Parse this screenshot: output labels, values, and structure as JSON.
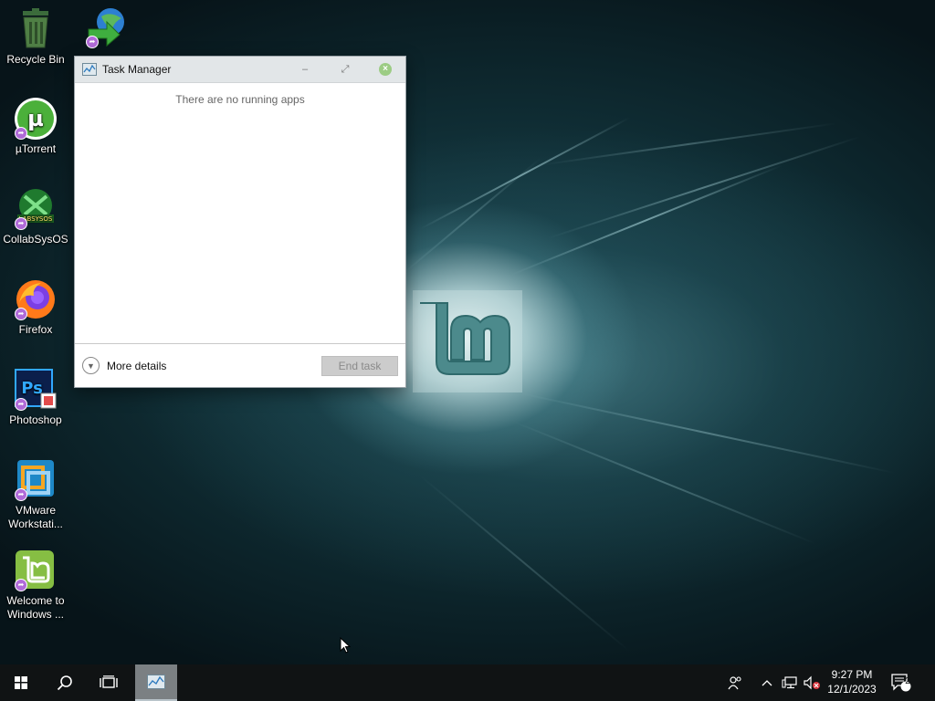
{
  "desktop": {
    "icons": [
      {
        "name": "recycle-bin",
        "label": "Recycle Bin"
      },
      {
        "name": "internet-download-manager",
        "label": ""
      },
      {
        "name": "utorrent",
        "label": "µTorrent"
      },
      {
        "name": "collabsysos",
        "label": "CollabSysOS",
        "badge_text": "LABSYSOS"
      },
      {
        "name": "firefox",
        "label": "Firefox"
      },
      {
        "name": "photoshop",
        "label": "Photoshop",
        "badge_text": "Ps"
      },
      {
        "name": "vmware-workstation",
        "label": "VMware Workstati..."
      },
      {
        "name": "welcome-to-windows",
        "label": "Welcome to Windows ..."
      }
    ]
  },
  "task_manager": {
    "title": "Task Manager",
    "minimize_glyph": "–",
    "maximize_glyph": "⤢",
    "close_glyph": "×",
    "empty_message": "There are no running apps",
    "more_details": "More details",
    "end_task": "End task",
    "end_task_enabled": false
  },
  "taskbar": {
    "start_icon": "windows-start-icon",
    "search_icon": "search-icon",
    "task_view_icon": "task-view-icon",
    "pinned_app": "task-manager",
    "tray": {
      "people_icon": "people-icon",
      "overflow_icon": "chevron-up-icon",
      "network_icon": "network-icon",
      "volume_icon": "volume-muted-icon"
    },
    "clock": {
      "time": "9:27 PM",
      "date": "12/1/2023"
    },
    "notifications_count": "2"
  },
  "colors": {
    "taskbar_bg": "#101314",
    "desktop_bg": "#0f2c33",
    "window_title_bg": "#e2e6e8",
    "close_button": "#9ccc84"
  }
}
